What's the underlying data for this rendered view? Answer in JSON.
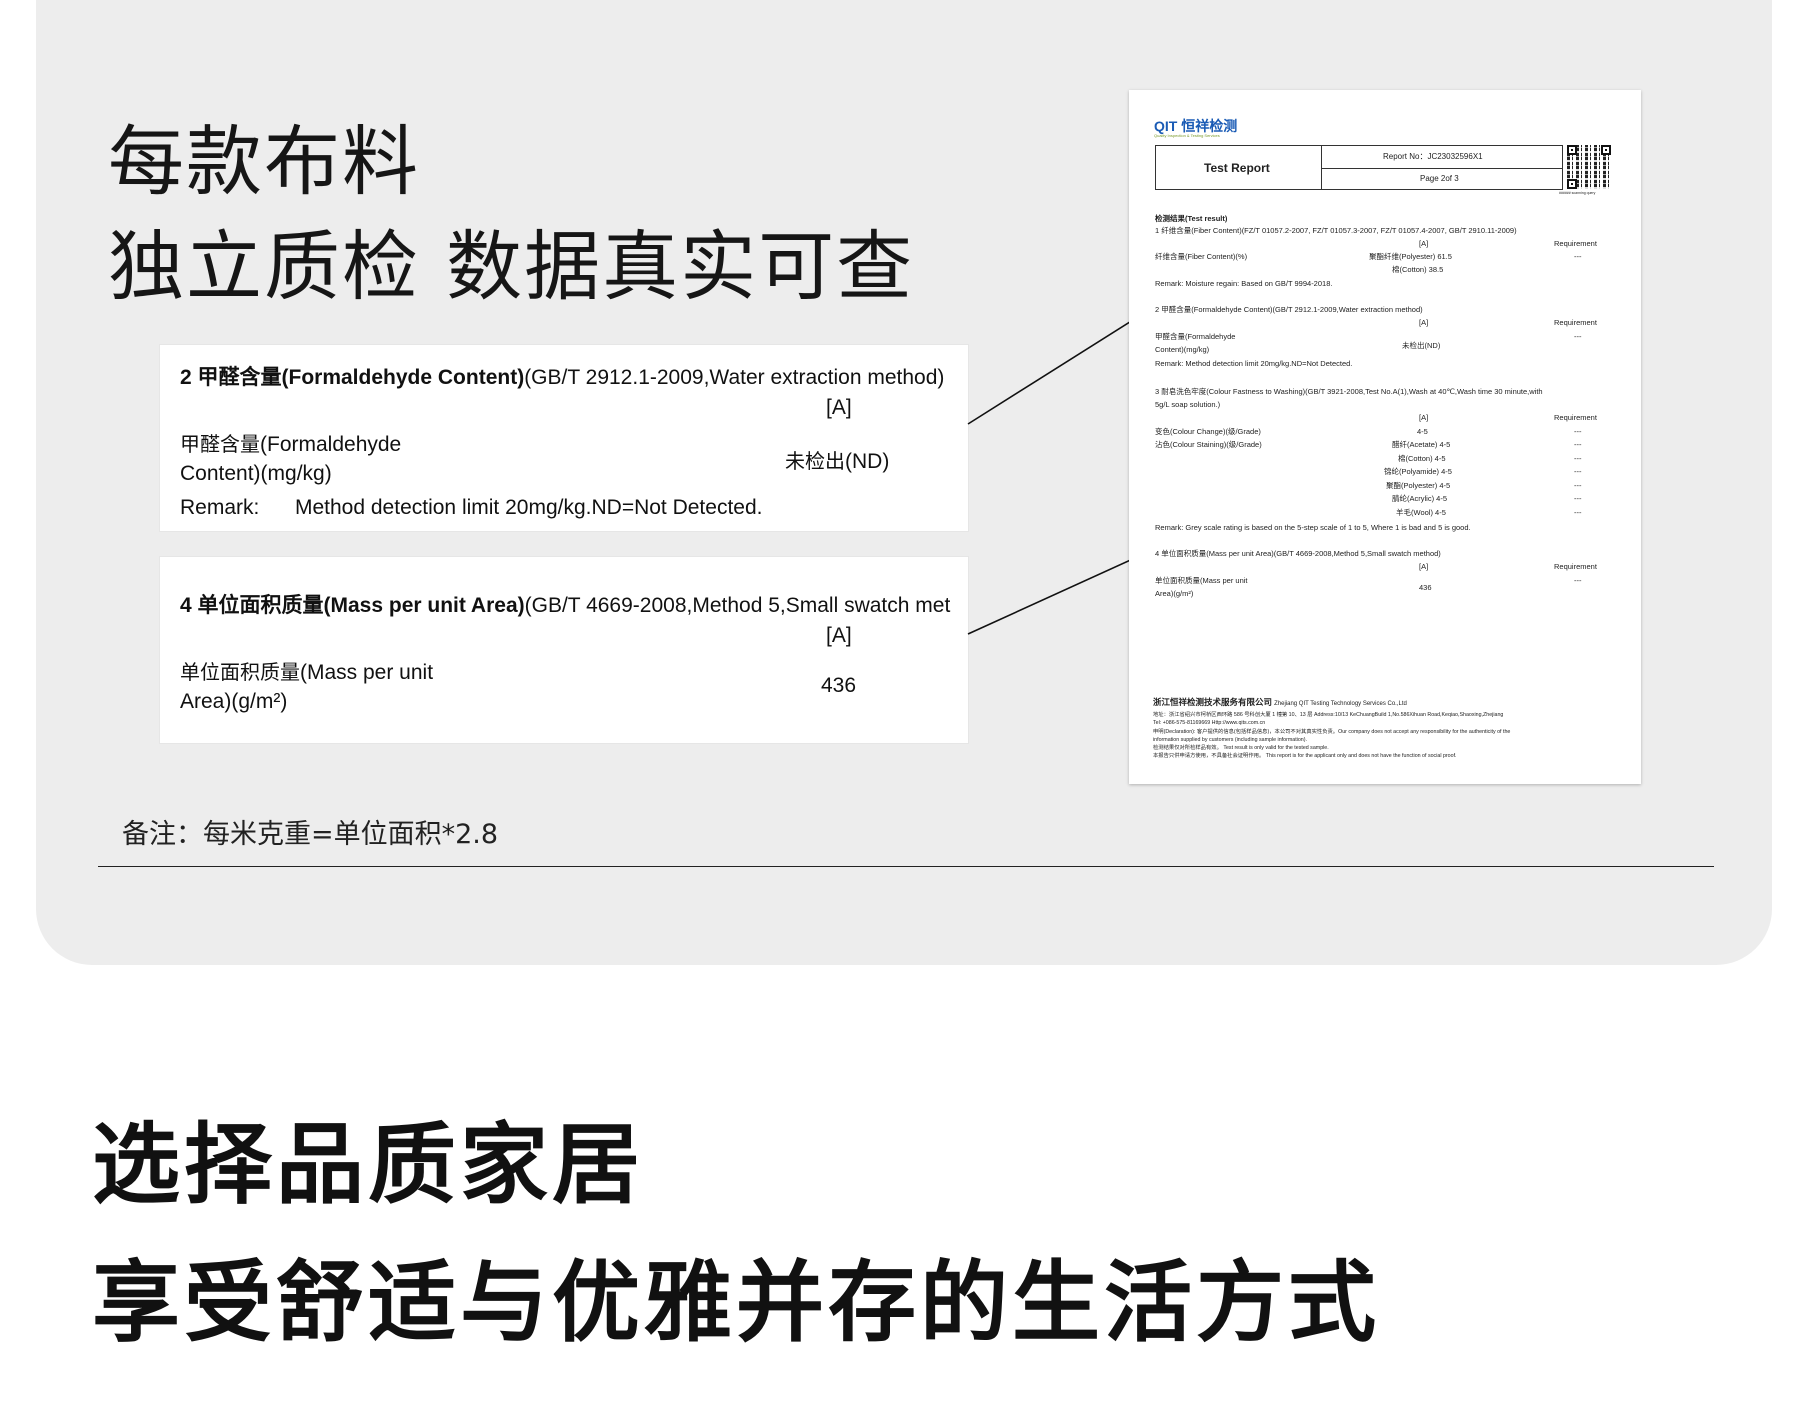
{
  "headline": {
    "line1": "每款布料",
    "line2": "独立质检 数据真实可查"
  },
  "card_formaldehyde": {
    "title_bold": "2 甲醛含量(Formaldehyde Content)",
    "title_rest": "(GB/T 2912.1-2009,Water extraction method)",
    "col_a": "[A]",
    "item_line1": "甲醛含量(Formaldehyde",
    "item_line2": "Content)(mg/kg)",
    "value": "未检出(ND)",
    "remark_label": "Remark:",
    "remark_text": "Method detection limit 20mg/kg.ND=Not Detected."
  },
  "card_mass": {
    "title_bold": "4 单位面积质量(Mass per unit Area)",
    "title_rest": "(GB/T 4669-2008,Method 5,Small swatch met",
    "col_a": "[A]",
    "item_line1": "单位面积质量(Mass per unit",
    "item_line2": "Area)(g/m²)",
    "value": "436"
  },
  "note": "备注：每米克重=单位面积*2.8",
  "tagline": {
    "line1": "选择品质家居",
    "line2": "享受舒适与优雅并存的生活方式"
  },
  "report": {
    "logo": "QIT 恒祥检测",
    "logo_sub": "Quality Inspection & Testing Services",
    "test_report": "Test Report",
    "report_no": "Report No：JC23032596X1",
    "page": "Page 2of 3",
    "qr_caption": "###### scanning query",
    "result_heading": "检测结果(Test result)",
    "s1_title": "1 纤维含量(Fiber Content)(FZ/T 01057.2-2007, FZ/T 01057.3-2007, FZ/T 01057.4-2007, GB/T 2910.11-2009)",
    "s1_a": "[A]",
    "s1_req": "Requirement",
    "s1_item": "纤维含量(Fiber Content)(%)",
    "s1_v1": "聚酯纤维(Polyester)   61.5",
    "s1_v2": "棉(Cotton)   38.5",
    "s1_dash": "---",
    "s1_remark": "Remark:    Moisture regain: Based on GB/T 9994-2018.",
    "s2_title": "2 甲醛含量(Formaldehyde Content)(GB/T 2912.1-2009,Water extraction method)",
    "s2_a": "[A]",
    "s2_req": "Requirement",
    "s2_item1": "甲醛含量(Formaldehyde",
    "s2_item2": "Content)(mg/kg)",
    "s2_val": "未检出(ND)",
    "s2_dash": "---",
    "s2_remark": "Remark:    Method detection limit 20mg/kg.ND=Not Detected.",
    "s3_title1": "3 耐皂洗色牢度(Colour Fastness to Washing)(GB/T 3921-2008,Test No.A(1),Wash at 40℃,Wash time 30 minute,with",
    "s3_title2": "5g/L soap solution.)",
    "s3_a": "[A]",
    "s3_req": "Requirement",
    "s3_item1": "变色(Colour Change)(级/Grade)",
    "s3_item2": "沾色(Colour Staining)(级/Grade)",
    "s3_vals": [
      "4-5",
      "醋纤(Acetate) 4-5",
      "棉(Cotton) 4-5",
      "锦纶(Polyamide) 4-5",
      "聚酯(Polyester) 4-5",
      "腈纶(Acrylic) 4-5",
      "羊毛(Wool) 4-5"
    ],
    "s3_dash": "---",
    "s3_remark": "Remark:    Grey scale rating is based on the 5-step scale of 1 to 5,  Where 1 is bad and 5 is good.",
    "s4_title": "4 单位面积质量(Mass per unit Area)(GB/T 4669-2008,Method 5,Small swatch method)",
    "s4_a": "[A]",
    "s4_req": "Requirement",
    "s4_item1": "单位面积质量(Mass per unit",
    "s4_item2": "Area)(g/m²)",
    "s4_val": "436",
    "s4_dash": "---",
    "footer_company": "浙江恒祥检测技术服务有限公司",
    "footer_company_en": "Zhejiang QIT Testing Technology Services Co.,Ltd",
    "footer_addr": "地址：浙江省绍兴市柯桥区西环路 586 号科创大厦 1 幢第 10、13 层  Address:10/13 KeChuangBuild 1,No.586Xihuan Road,Keqiao,Shaoxing,Zhejiang",
    "footer_tel": "Tel:  +086-575-81169669    Http://www.qits.com.cn",
    "footer_decl1": "申明(Declaration): 客户提供的信息(包括样品信息)，本公司不对其真实性负责。Our company does not accept any responsibility for the authenticity of the",
    "footer_decl2": "information supplied by customers (including sample information).",
    "footer_decl3": "检测结果仅对所检样品有效。 Test result is only valid for the tested sample.",
    "footer_decl4": "本报告只供申请方使用，不具备社会证明作用。 This report is for the applicant only and does not have the function of social proof."
  }
}
